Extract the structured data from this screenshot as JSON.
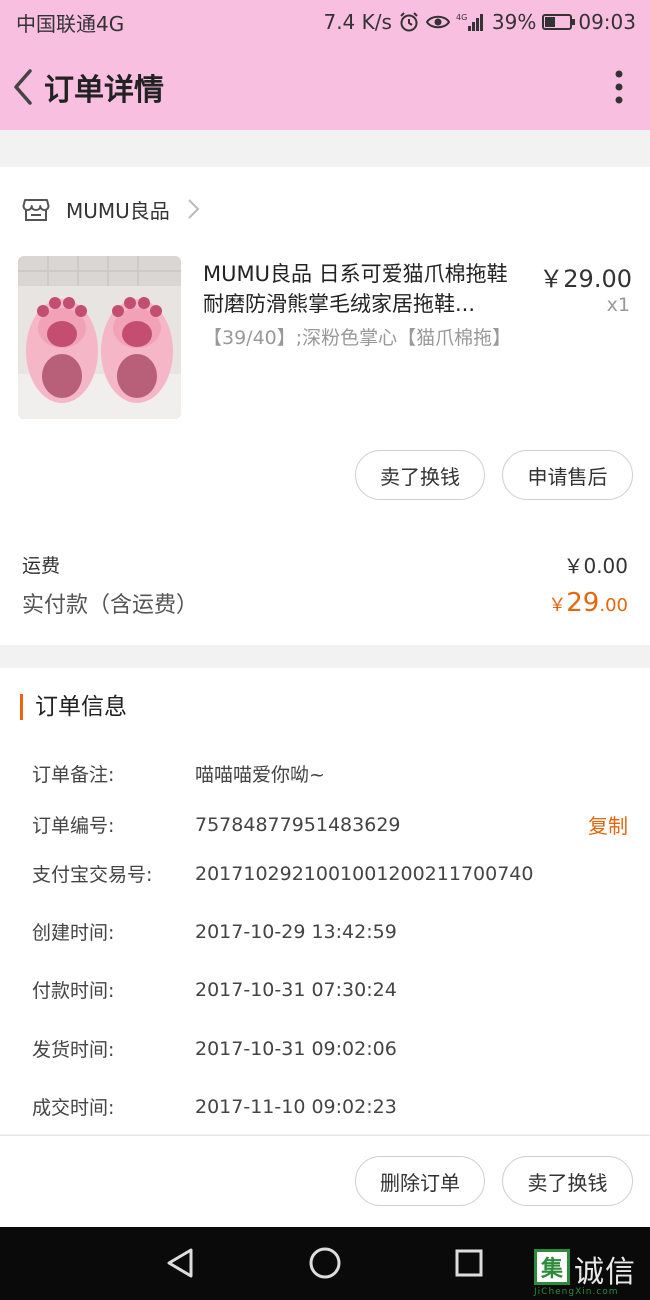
{
  "status_bar": {
    "carrier": "中国联通4G",
    "speed": "7.4 K/s",
    "battery": "39%",
    "time": "09:03"
  },
  "nav": {
    "title": "订单详情",
    "back_icon": "chevron-left-icon",
    "more_icon": "more-vertical-icon"
  },
  "store": {
    "name": "MUMU良品"
  },
  "product": {
    "title": "MUMU良品 日系可爱猫爪棉拖鞋 耐磨防滑熊掌毛绒家居拖鞋...",
    "price": "￥29.00",
    "qty": "x1",
    "sku": "【39/40】;深粉色掌心【猫爪棉拖】"
  },
  "item_actions": {
    "sell": "卖了换钱",
    "after_sale": "申请售后"
  },
  "fees": {
    "shipping_label": "运费",
    "shipping_value": "￥0.00",
    "paid_label": "实付款（含运费）",
    "paid_currency": "￥",
    "paid_int": "29",
    "paid_dec": ".00"
  },
  "order_info": {
    "title": "订单信息",
    "rows": [
      {
        "key": "订单备注:",
        "value": "喵喵喵爱你呦~"
      },
      {
        "key": "订单编号:",
        "value": "75784877951483629"
      },
      {
        "key": "支付宝交易号:",
        "value": "2017102921001001200211700740"
      },
      {
        "key": "创建时间:",
        "value": "2017-10-29 13:42:59"
      },
      {
        "key": "付款时间:",
        "value": "2017-10-31 07:30:24"
      },
      {
        "key": "发货时间:",
        "value": "2017-10-31 09:02:06"
      },
      {
        "key": "成交时间:",
        "value": "2017-11-10 09:02:23"
      }
    ],
    "copy_label": "复制"
  },
  "bottom_actions": {
    "delete": "删除订单",
    "sell": "卖了换钱"
  },
  "watermark": {
    "box_char": "集",
    "text": "诚信",
    "sub": "JiChengXin.com"
  },
  "colors": {
    "header_bg": "#f9bfe1",
    "accent": "#e8650c"
  }
}
